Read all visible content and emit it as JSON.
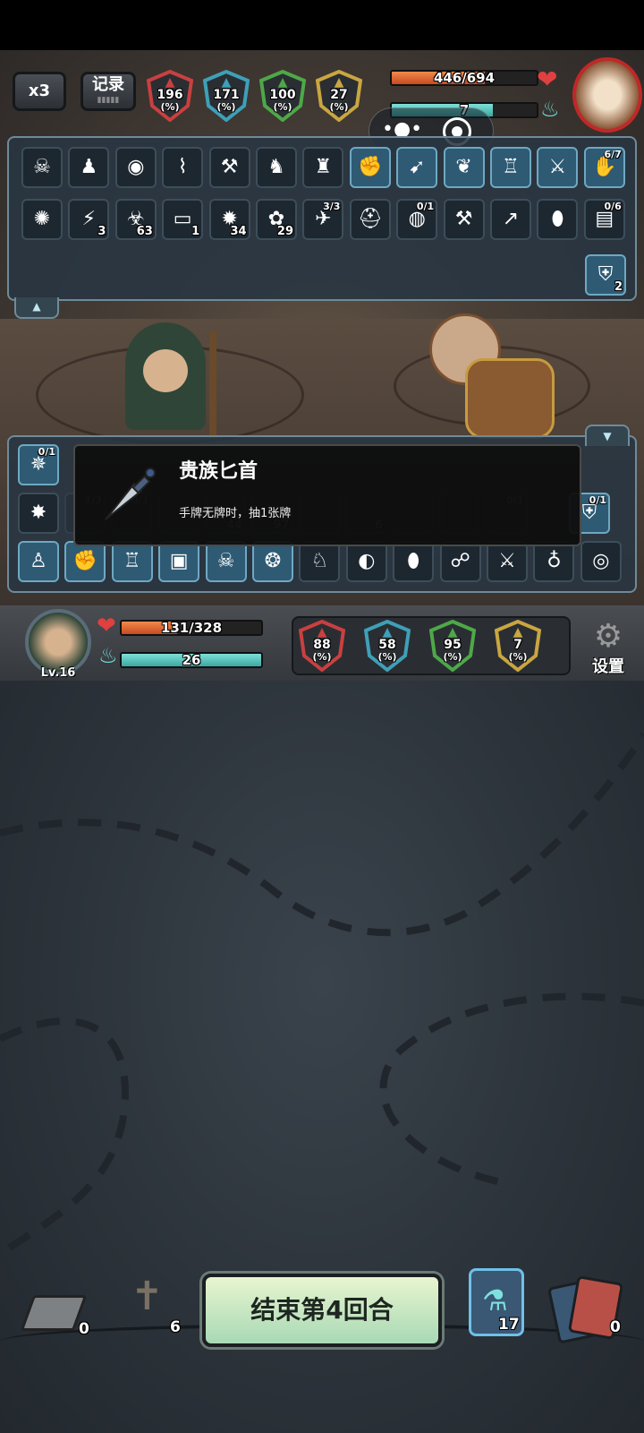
{
  "top_buttons": {
    "speed": "x3",
    "log": "记录"
  },
  "enemy": {
    "hp": "446/694",
    "hp_fraction": 0.64,
    "energy": "7",
    "energy_fraction": 0.7,
    "stats": [
      {
        "name": "attack",
        "value": "196",
        "unit": "(%)",
        "color": "#c94040"
      },
      {
        "name": "crit",
        "value": "171",
        "unit": "(%)",
        "color": "#3ea0b8"
      },
      {
        "name": "defense",
        "value": "100",
        "unit": "(%)",
        "color": "#4ea848"
      },
      {
        "name": "speed",
        "value": "27",
        "unit": "(%)",
        "color": "#c9a640"
      }
    ]
  },
  "enemy_buffs_row1": [
    {
      "icon": "dark-mask-icon",
      "count": ""
    },
    {
      "icon": "voodoo-doll-icon",
      "count": ""
    },
    {
      "icon": "green-rune-icon",
      "count": ""
    },
    {
      "icon": "spike-trap-icon",
      "count": ""
    },
    {
      "icon": "hammer-icon",
      "count": ""
    },
    {
      "icon": "mecha-cat-icon",
      "count": ""
    },
    {
      "icon": "strongman-icon",
      "count": ""
    },
    {
      "icon": "muscle-icon",
      "count": ""
    },
    {
      "icon": "runner-icon",
      "count": ""
    },
    {
      "icon": "wings-icon",
      "count": ""
    },
    {
      "icon": "totem-icon",
      "count": ""
    },
    {
      "icon": "sword-icon",
      "count": ""
    },
    {
      "icon": "claw-icon",
      "count": "6/7"
    }
  ],
  "enemy_buffs_row2": [
    {
      "icon": "whirlwind-icon",
      "count": ""
    },
    {
      "icon": "lightning-icon",
      "count": "3"
    },
    {
      "icon": "poison-skull-icon",
      "count": "63"
    },
    {
      "icon": "scroll-icon",
      "count": "1"
    },
    {
      "icon": "burst-icon",
      "count": "34"
    },
    {
      "icon": "thorns-icon",
      "count": "29"
    },
    {
      "icon": "mecha-bird-icon",
      "count": "3/3"
    },
    {
      "icon": "helmet-icon",
      "count": ""
    },
    {
      "icon": "galaxy-icon",
      "count": "0/1"
    },
    {
      "icon": "mallet-icon",
      "count": ""
    },
    {
      "icon": "drill-icon",
      "count": ""
    },
    {
      "icon": "egg-icon",
      "count": ""
    },
    {
      "icon": "map-icon",
      "count": "0/6"
    }
  ],
  "enemy_armor": "2",
  "tooltip": {
    "title": "贵族匕首",
    "desc": "手牌无牌时，抽1张牌"
  },
  "player_buffs_row1": [
    {
      "icon": "spirit-icon",
      "count": "0/1"
    }
  ],
  "player_buffs_row2_left": [
    {
      "icon": "spiked-ball-icon",
      "count": ""
    }
  ],
  "player_buffs_row2_hidden": [
    {
      "count": "1/3"
    },
    {
      "count": "0/1"
    },
    {
      "count": ""
    },
    {
      "count": "44"
    },
    {
      "count": "97"
    },
    {
      "count": ""
    },
    {
      "count": "6"
    },
    {
      "count": ""
    },
    {
      "count": ""
    },
    {
      "count": "0/1"
    }
  ],
  "player_buffs_row2_right": [
    {
      "icon": "shield-icon",
      "count": "0/1"
    }
  ],
  "player_buffs_row3": [
    {
      "icon": "figure-icon"
    },
    {
      "icon": "fist-icon"
    },
    {
      "icon": "totem-icon"
    },
    {
      "icon": "crate-icon"
    },
    {
      "icon": "skull-icon"
    },
    {
      "icon": "pumpkin-icon"
    },
    {
      "icon": "frog-icon"
    },
    {
      "icon": "slime-icon"
    },
    {
      "icon": "egg-icon"
    },
    {
      "icon": "bone-icon"
    },
    {
      "icon": "dagger-icon"
    },
    {
      "icon": "pouch-icon"
    },
    {
      "icon": "stump-icon"
    }
  ],
  "player": {
    "level": "Lv.16",
    "hp": "131/328",
    "hp_fraction": 0.4,
    "energy": "26",
    "energy_fraction": 1.0,
    "stats": [
      {
        "name": "attack",
        "value": "88",
        "unit": "(%)",
        "color": "#c94040"
      },
      {
        "name": "crit",
        "value": "58",
        "unit": "(%)",
        "color": "#3ea0b8"
      },
      {
        "name": "defense",
        "value": "95",
        "unit": "(%)",
        "color": "#4ea848"
      },
      {
        "name": "speed",
        "value": "7",
        "unit": "(%)",
        "color": "#c9a640"
      }
    ],
    "settings_label": "设置"
  },
  "bottom": {
    "draw_pile": "0",
    "grave_pile": "6",
    "end_turn_label": "结束第4回合",
    "potion_deck": "17",
    "discard_pile": "0"
  }
}
